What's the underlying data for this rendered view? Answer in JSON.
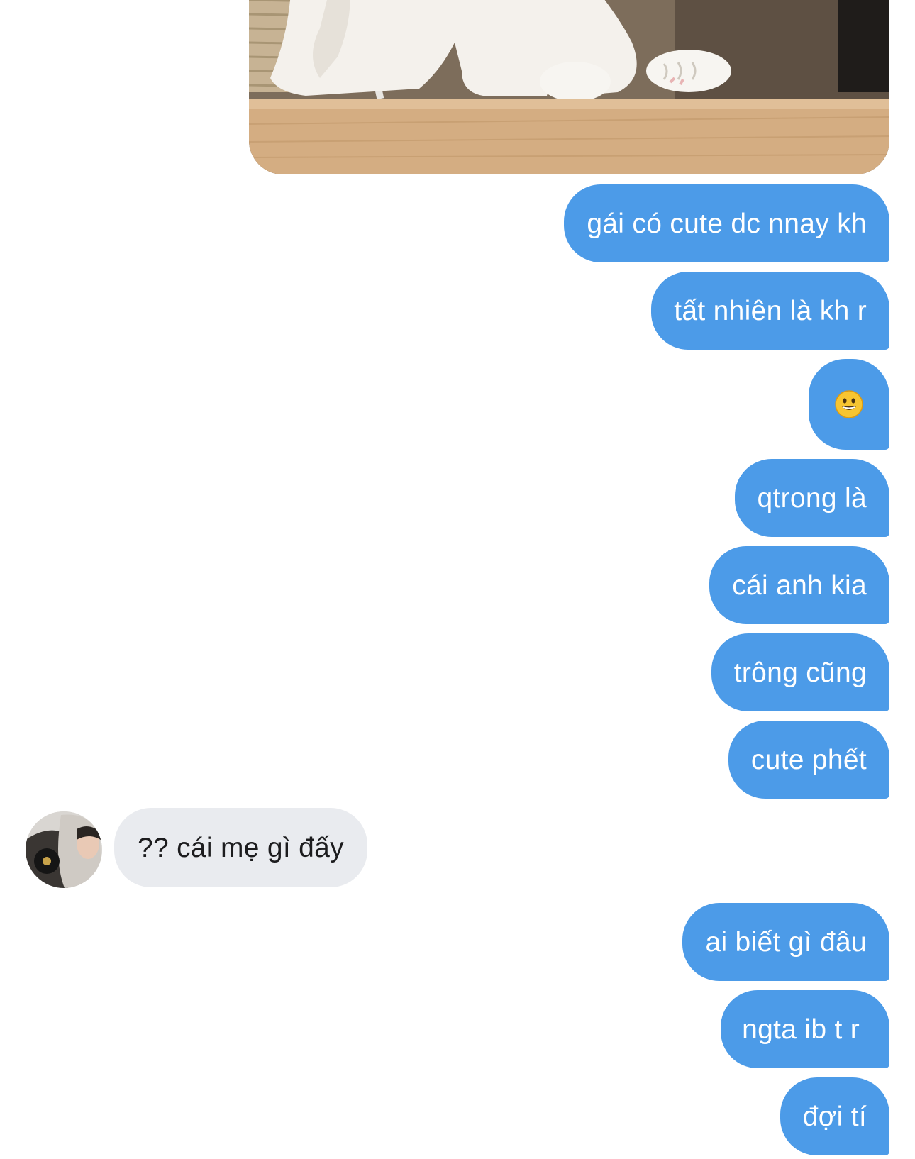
{
  "conversation": {
    "photo": {
      "alt": "",
      "colors": {
        "fur": "#f4f1ec",
        "shelf": "#c9a27a",
        "background": "#7d6d5b"
      }
    },
    "messages": [
      {
        "id": "m1",
        "direction": "outgoing",
        "text": "gái có cute dc nnay kh"
      },
      {
        "id": "m2",
        "direction": "outgoing",
        "text": "tất nhiên là kh r"
      },
      {
        "id": "m3",
        "direction": "outgoing",
        "text": "",
        "icon": "grinning-face-emoji"
      },
      {
        "id": "m4",
        "direction": "outgoing",
        "text": "qtrong là"
      },
      {
        "id": "m5",
        "direction": "outgoing",
        "text": "cái anh kia"
      },
      {
        "id": "m6",
        "direction": "outgoing",
        "text": "trông cũng"
      },
      {
        "id": "m7",
        "direction": "outgoing",
        "text": "cute phết"
      },
      {
        "id": "m8",
        "direction": "incoming",
        "text": "?? cái mẹ gì đấy",
        "avatar_icon": "contact-avatar"
      },
      {
        "id": "m9",
        "direction": "outgoing",
        "text": "ai biết gì đâu"
      },
      {
        "id": "m10",
        "direction": "outgoing",
        "text": "ngta ib t r"
      },
      {
        "id": "m11",
        "direction": "outgoing",
        "text": "đợi tí"
      }
    ]
  },
  "theme": {
    "outgoing_bubble": "#4c9be8",
    "incoming_bubble": "#e9ebef",
    "outgoing_text": "#ffffff",
    "incoming_text": "#1c1c1e"
  }
}
